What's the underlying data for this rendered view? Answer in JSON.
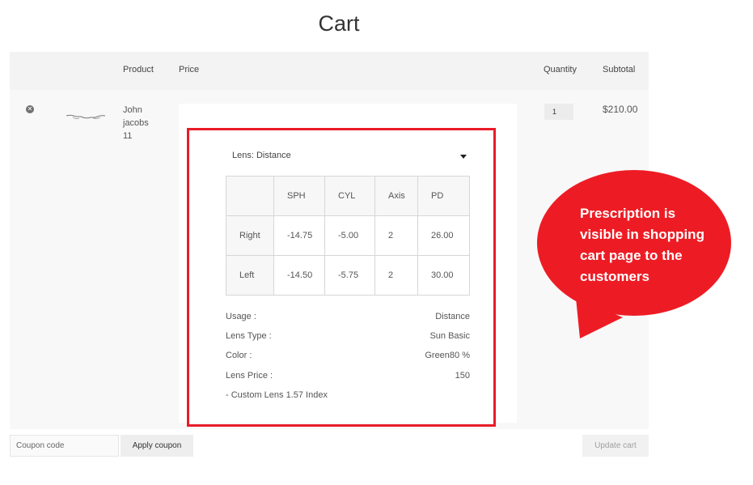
{
  "page": {
    "title": "Cart"
  },
  "table": {
    "headers": {
      "product": "Product",
      "price": "Price",
      "quantity": "Quantity",
      "subtotal": "Subtotal"
    }
  },
  "item": {
    "name_lines": [
      "John",
      "jacobs",
      "11"
    ],
    "quantity": "1",
    "subtotal": "$210.00"
  },
  "lens": {
    "toggle_label": "Lens: Distance",
    "prescription": {
      "columns": [
        "",
        "SPH",
        "CYL",
        "Axis",
        "PD"
      ],
      "rows": [
        [
          "Right",
          "-14.75",
          "-5.00",
          "2",
          "26.00"
        ],
        [
          "Left",
          "-14.50",
          "-5.75",
          "2",
          "30.00"
        ]
      ]
    },
    "details": [
      {
        "label": "Usage :",
        "value": "Distance"
      },
      {
        "label": "Lens Type :",
        "value": "Sun Basic"
      },
      {
        "label": "Color :",
        "value": "Green80 %"
      },
      {
        "label": "Lens Price :",
        "value": "150"
      }
    ],
    "extra": "- Custom Lens 1.57 Index"
  },
  "actions": {
    "coupon_placeholder": "Coupon code",
    "apply_coupon": "Apply coupon",
    "update_cart": "Update cart"
  },
  "callout": {
    "text": "Prescription is visible in shopping cart page to the customers"
  },
  "colors": {
    "highlight": "#e81c28",
    "callout_fill": "#ed1c24"
  }
}
